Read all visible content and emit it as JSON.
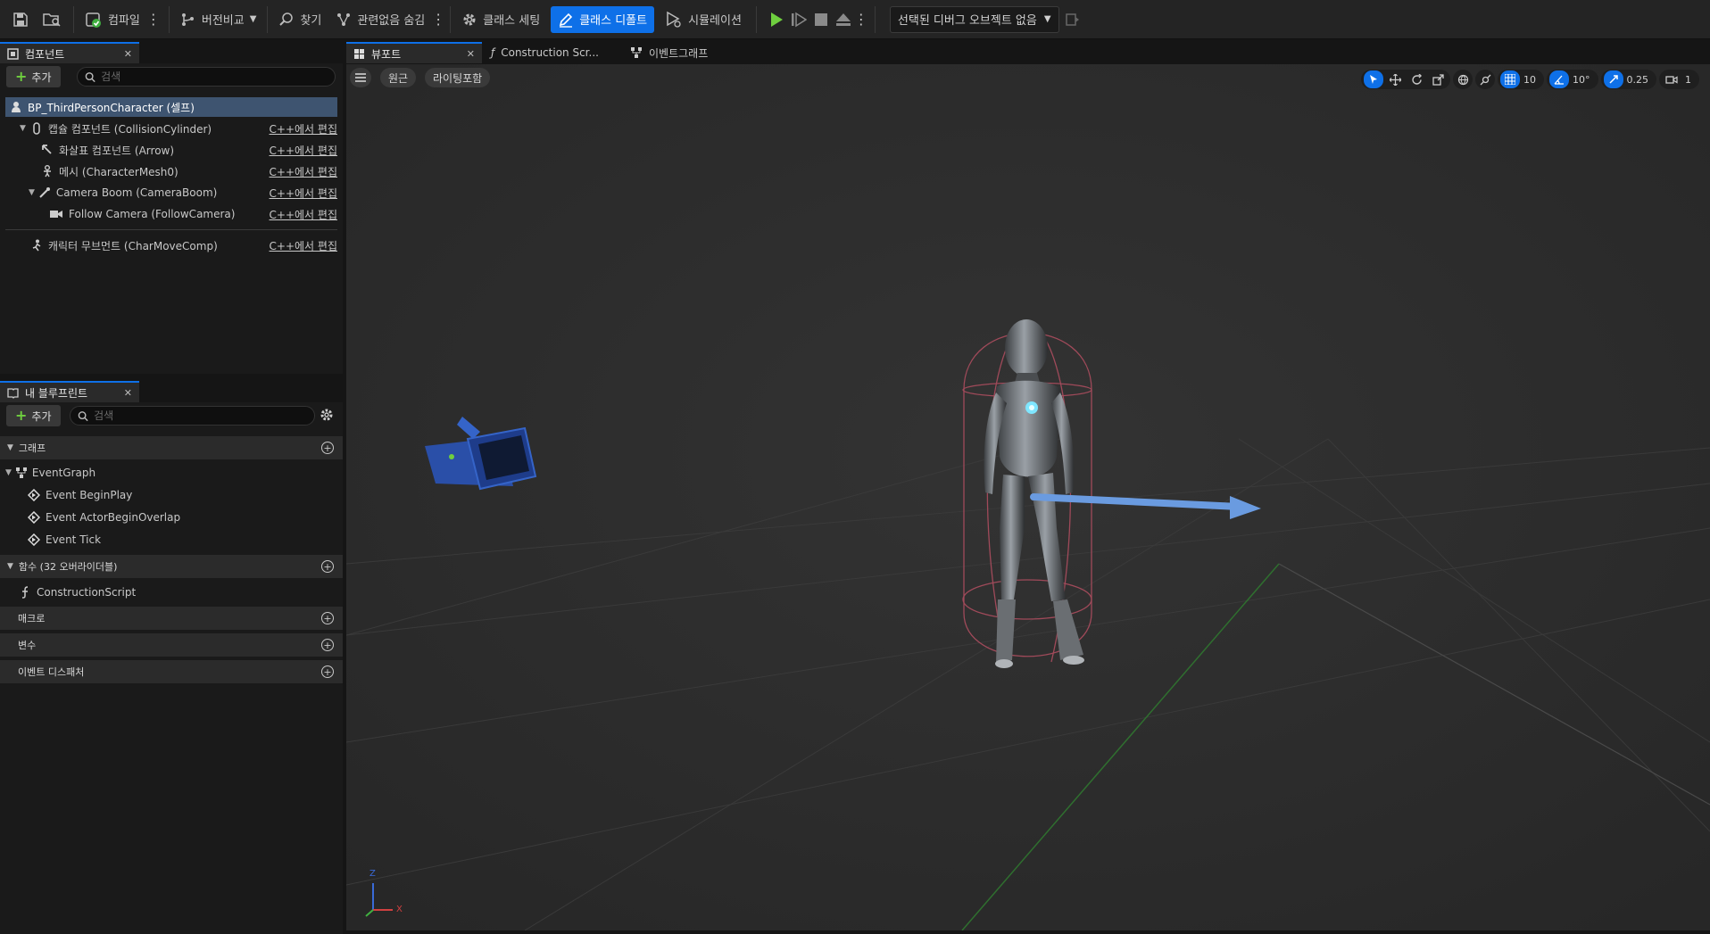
{
  "colors": {
    "accent": "#0e70e8",
    "play_green": "#6fcf3f",
    "selection_row": "#3e5470",
    "viewport_bg": "#2c2c2c"
  },
  "toolbar": {
    "compile_label": "컴파일",
    "diff_label": "버전비교",
    "find_label": "찾기",
    "hide_unrelated_label": "관련없음 숨김",
    "class_settings_label": "클래스 세팅",
    "class_defaults_label": "클래스 디폴트",
    "simulation_label": "시뮬레이션",
    "debug_object_label": "선택된 디버그 오브젝트 없음"
  },
  "components_panel": {
    "tab_label": "컴포넌트",
    "add_label": "추가",
    "search_placeholder": "검색",
    "edit_label": "C++에서 편집",
    "items": [
      {
        "label": "BP_ThirdPersonCharacter (셀프)"
      },
      {
        "label": "캡슐 컴포넌트 (CollisionCylinder)"
      },
      {
        "label": "화살표 컴포넌트 (Arrow)"
      },
      {
        "label": "메시 (CharacterMesh0)"
      },
      {
        "label": "Camera Boom (CameraBoom)"
      },
      {
        "label": "Follow Camera (FollowCamera)"
      },
      {
        "label": "캐릭터 무브먼트 (CharMoveComp)"
      }
    ]
  },
  "my_blueprint_panel": {
    "tab_label": "내 블루프린트",
    "add_label": "추가",
    "search_placeholder": "검색",
    "sections": {
      "graphs": "그래프",
      "functions": "함수 (32 오버라이더블)",
      "macros": "매크로",
      "variables": "변수",
      "event_dispatchers": "이벤트 디스패처"
    },
    "event_graph": "EventGraph",
    "events": [
      "Event BeginPlay",
      "Event ActorBeginOverlap",
      "Event Tick"
    ],
    "construction_script": "ConstructionScript"
  },
  "editor_tabs": {
    "viewport": "뷰포트",
    "construction_script": "Construction Scr...",
    "event_graph": "이벤트그래프"
  },
  "viewport": {
    "perspective_label": "원근",
    "lighting_label": "라이팅포함",
    "grid_snap": "10",
    "rotation_snap": "10°",
    "scale_snap": "0.25",
    "camera_speed": "1",
    "axis_x": "X",
    "axis_z": "Z"
  }
}
